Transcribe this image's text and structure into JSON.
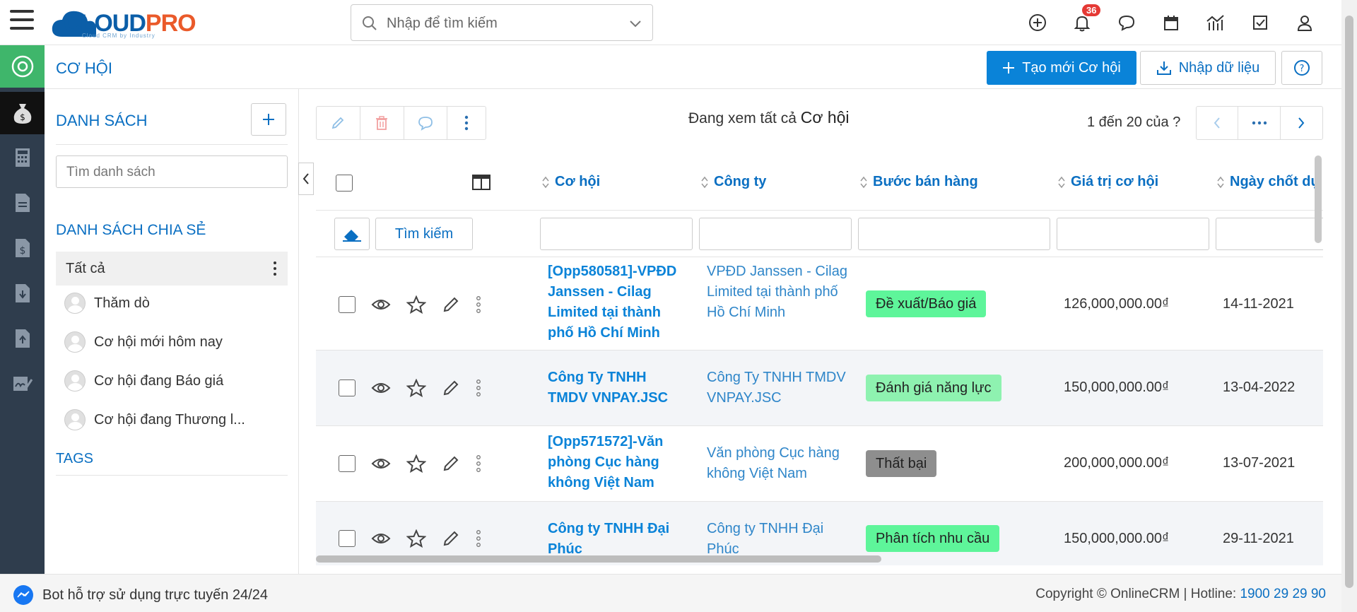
{
  "app": {
    "logo_main_1": "CLOUD",
    "logo_main_2": "PRO",
    "logo_sub": "Cloud CRM by Industry",
    "search_placeholder": "Nhập để tìm kiếm",
    "notifications_count": "36"
  },
  "page": {
    "title": "CƠ HỘI",
    "create_button": "Tạo mới Cơ hội",
    "import_button": "Nhập dữ liệu"
  },
  "list_panel": {
    "title": "DANH SÁCH",
    "search_placeholder": "Tìm danh sách",
    "shared_title": "DANH SÁCH CHIA SẺ",
    "all_label": "Tất cả",
    "items": [
      {
        "label": "Thăm dò"
      },
      {
        "label": "Cơ hội mới hôm nay"
      },
      {
        "label": "Cơ hội đang Báo giá"
      },
      {
        "label": "Cơ hội đang Thương l..."
      }
    ],
    "tags_title": "TAGS"
  },
  "main": {
    "viewing_prefix": "Đang xem tất cả",
    "viewing_entity": "Cơ hội",
    "pager_text": "1 đến 20 của",
    "pager_unknown": "?",
    "search_button": "Tìm kiếm",
    "columns": [
      "Cơ hội",
      "Công ty",
      "Bước bán hàng",
      "Giá trị cơ hội",
      "Ngày chốt dự"
    ],
    "rows": [
      {
        "opportunity": "[Opp580581]-VPĐD Janssen - Cilag Limited tại thành phố Hồ Chí Minh",
        "company": "VPĐD Janssen - Cilag Limited tại thành phố Hồ Chí Minh",
        "stage": "Đề xuất/Báo giá",
        "stage_color": "#5ef59a",
        "value": "126,000,000.00₫",
        "date": "14-11-2021"
      },
      {
        "opportunity": "Công Ty TNHH TMDV VNPAY.JSC",
        "company": "Công Ty TNHH TMDV VNPAY.JSC",
        "stage": "Đánh giá năng lực",
        "stage_color": "#8ef2b0",
        "value": "150,000,000.00₫",
        "date": "13-04-2022"
      },
      {
        "opportunity": "[Opp571572]-Văn phòng Cục hàng không Việt Nam",
        "company": "Văn phòng Cục hàng không Việt Nam",
        "stage": "Thất bại",
        "stage_color": "#8e8e8e",
        "value": "200,000,000.00₫",
        "date": "13-07-2021"
      },
      {
        "opportunity": "Công ty TNHH Đại Phúc",
        "company": "Công ty TNHH Đại Phúc",
        "stage": "Phân tích nhu cầu",
        "stage_color": "#5ef59a",
        "value": "150,000,000.00₫",
        "date": "29-11-2021"
      }
    ]
  },
  "footer": {
    "bot_text": "Bot hỗ trợ sử dụng trực tuyến 24/24",
    "copyright": "Copyright © OnlineCRM | Hotline:",
    "hotline": "1900 29 29 90"
  },
  "colors": {
    "accent": "#0a83d8",
    "active_module": "#3fb66b",
    "sidebar": "#2f3d4d"
  }
}
